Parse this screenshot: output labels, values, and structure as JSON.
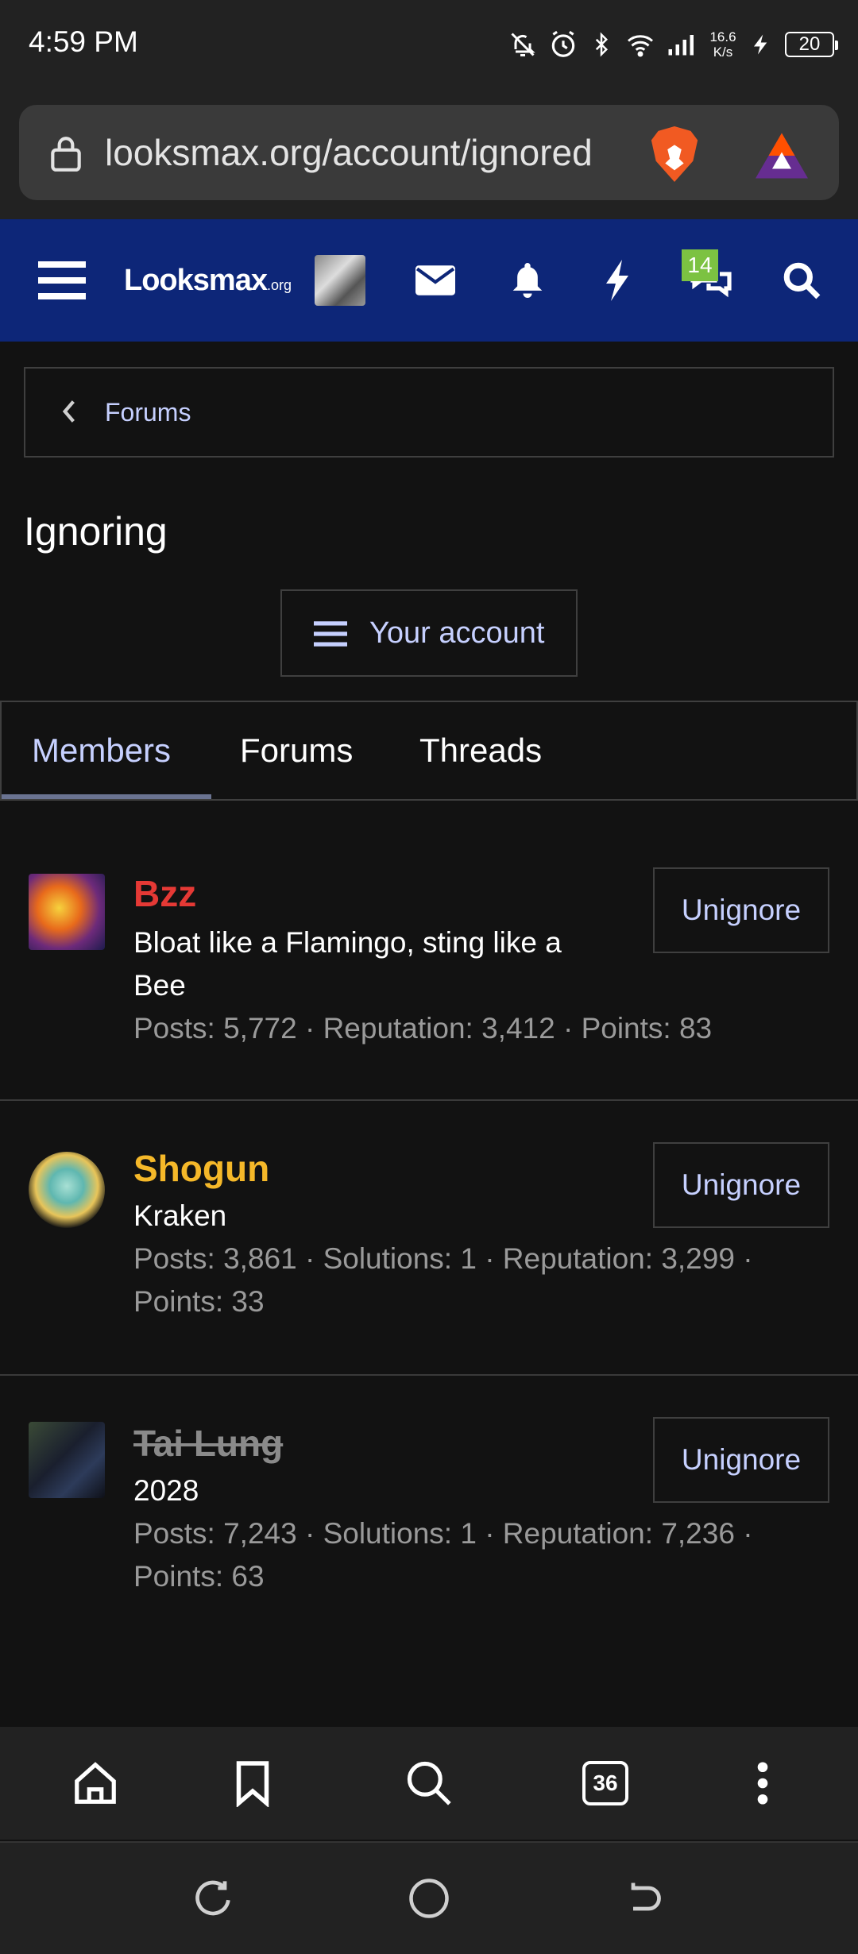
{
  "status_bar": {
    "time": "4:59 PM",
    "net_speed_value": "16.6",
    "net_speed_unit": "K/s",
    "battery": "20"
  },
  "browser": {
    "url": "looksmax.org/account/ignored"
  },
  "site_header": {
    "logo_main": "Looksmax",
    "logo_suffix": ".org",
    "conversations_badge": "14"
  },
  "breadcrumb": {
    "label": "Forums"
  },
  "page": {
    "title": "Ignoring",
    "account_button": "Your account"
  },
  "tabs": [
    {
      "label": "Members",
      "active": true
    },
    {
      "label": "Forums",
      "active": false
    },
    {
      "label": "Threads",
      "active": false
    }
  ],
  "members": [
    {
      "name": "Bzz",
      "name_color": "#e53935",
      "title": "Bloat like a Flamingo, sting like a Bee",
      "stats": "Posts: 5,772 · Reputation: 3,412 · Points: 83",
      "button": "Unignore"
    },
    {
      "name": "Shogun",
      "name_color": "#f5b829",
      "title": "Kraken",
      "stats": "Posts: 3,861 · Solutions: 1 · Reputation: 3,299 · Points: 33",
      "button": "Unignore"
    },
    {
      "name": "Tai Lung",
      "name_color": "#8a8a8a",
      "title": "2028",
      "stats": "Posts: 7,243 · Solutions: 1 · Reputation: 7,236 · Points: 63",
      "button": "Unignore"
    }
  ],
  "bottom_toolbar": {
    "tab_count": "36"
  },
  "icons": {
    "lock": "lock-icon",
    "brave": "brave-lion-icon",
    "rewards": "brave-rewards-icon",
    "menu": "hamburger-menu-icon",
    "mail": "envelope-icon",
    "bell": "bell-icon",
    "bolt": "lightning-icon",
    "chat": "chat-bubbles-icon",
    "search": "search-icon",
    "home": "home-icon",
    "bookmark": "bookmark-icon",
    "more": "more-vertical-icon"
  },
  "colors": {
    "header_bg": "#0d2678",
    "link": "#c6d0ff",
    "badge": "#7cc242"
  }
}
